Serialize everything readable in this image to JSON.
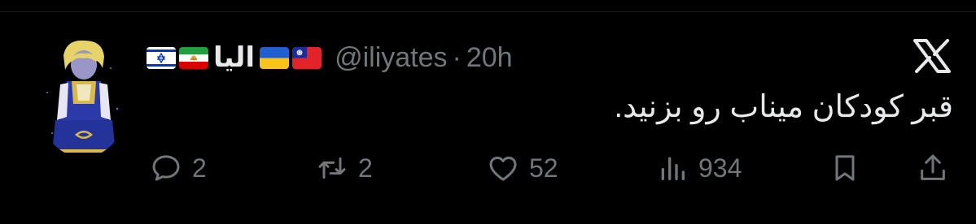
{
  "tweet": {
    "display_name": "اليا",
    "handle": "@iliyates",
    "separator": "·",
    "time": "20h",
    "text": "قبر کودکان میناب رو بزنید."
  },
  "flags": [
    "israel-flag-icon",
    "iran-lion-and-sun-flag-icon",
    "ukraine-flag-icon",
    "taiwan-flag-icon"
  ],
  "actions": {
    "replies": "2",
    "reposts": "2",
    "likes": "52",
    "views": "934"
  },
  "icons": {
    "platform": "x-logo-icon",
    "reply": "reply-icon",
    "repost": "repost-icon",
    "like": "heart-icon",
    "views": "views-icon",
    "bookmark": "bookmark-icon",
    "share": "share-icon"
  },
  "colors": {
    "background": "#000000",
    "text": "#e7e9ea",
    "muted": "#71767b"
  }
}
